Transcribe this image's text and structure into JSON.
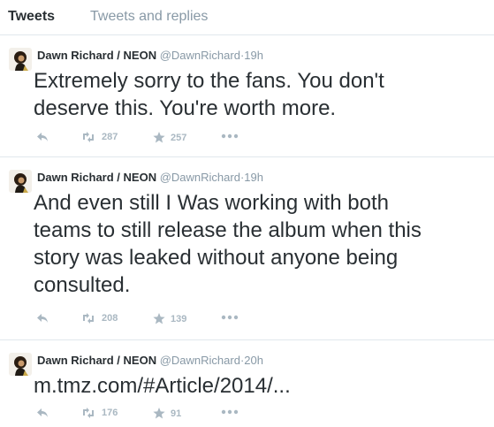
{
  "tabs": [
    {
      "label": "Tweets"
    },
    {
      "label": "Tweets and replies"
    }
  ],
  "tweets": [
    {
      "name": "Dawn Richard / NEON",
      "handle": "@DawnRichard",
      "separator": "·",
      "time": "19h",
      "text_lines": [
        "Extremely sorry to the fans. You don't",
        "deserve this. You're worth more."
      ],
      "retweets": "287",
      "favorites": "257"
    },
    {
      "name": "Dawn Richard / NEON",
      "handle": "@DawnRichard",
      "separator": "·",
      "time": "19h",
      "text_lines": [
        "And even still I Was working with both",
        "teams to still release the album when this",
        "story was leaked without anyone being",
        "consulted."
      ],
      "retweets": "208",
      "favorites": "139"
    },
    {
      "name": "Dawn Richard / NEON",
      "handle": "@DawnRichard",
      "separator": "·",
      "time": "20h",
      "text_lines": [
        "m.tmz.com/#Article/2014/..."
      ],
      "retweets": "176",
      "favorites": "91"
    }
  ],
  "icons": {
    "reply": "reply-icon",
    "retweet": "retweet-icon",
    "favorite": "star-icon",
    "more": "more-icon"
  },
  "colors": {
    "text": "#292f33",
    "muted": "#8899a6",
    "icon": "#aab8c2",
    "divider": "#e1e8ed"
  }
}
